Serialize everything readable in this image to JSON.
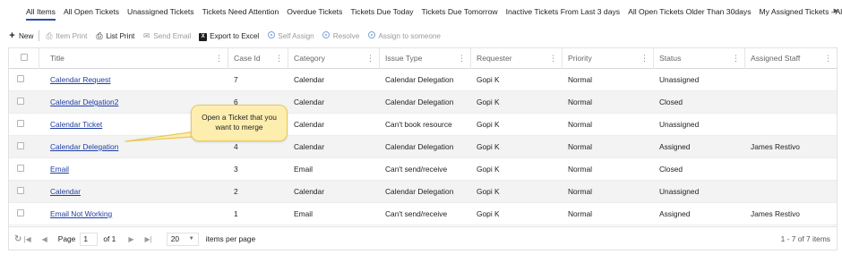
{
  "tabs": [
    {
      "label": "All Items",
      "active": true
    },
    {
      "label": "All Open Tickets"
    },
    {
      "label": "Unassigned Tickets"
    },
    {
      "label": "Tickets Need Attention"
    },
    {
      "label": "Overdue Tickets"
    },
    {
      "label": "Tickets Due Today"
    },
    {
      "label": "Tickets Due Tomorrow"
    },
    {
      "label": "Inactive Tickets From Last 3 days"
    },
    {
      "label": "All Open Tickets Older Than 30days"
    },
    {
      "label": "My Assigned Tickets - All"
    }
  ],
  "toolbar": {
    "new": "New",
    "item_print": "Item Print",
    "list_print": "List Print",
    "send_email": "Send Email",
    "export_excel": "Export to Excel",
    "self_assign": "Self Assign",
    "resolve": "Resolve",
    "assign_to_someone": "Assign to someone"
  },
  "columns": [
    "Title",
    "Case Id",
    "Category",
    "Issue Type",
    "Requester",
    "Priority",
    "Status",
    "Assigned Staff"
  ],
  "rows": [
    {
      "title": "Calendar Request",
      "case_id": "7",
      "category": "Calendar",
      "issue_type": "Calendar Delegation",
      "requester": "Gopi K",
      "priority": "Normal",
      "status": "Unassigned",
      "assigned_staff": ""
    },
    {
      "title": "Calendar Delgation2",
      "case_id": "6",
      "category": "Calendar",
      "issue_type": "Calendar Delegation",
      "requester": "Gopi K",
      "priority": "Normal",
      "status": "Closed",
      "assigned_staff": ""
    },
    {
      "title": "Calendar Ticket",
      "case_id": "5",
      "category": "Calendar",
      "issue_type": "Can't book resource",
      "requester": "Gopi K",
      "priority": "Normal",
      "status": "Unassigned",
      "assigned_staff": ""
    },
    {
      "title": "Calendar Delegation",
      "case_id": "4",
      "category": "Calendar",
      "issue_type": "Calendar Delegation",
      "requester": "Gopi K",
      "priority": "Normal",
      "status": "Assigned",
      "assigned_staff": "James Restivo"
    },
    {
      "title": "Email",
      "case_id": "3",
      "category": "Email",
      "issue_type": "Can't send/receive",
      "requester": "Gopi K",
      "priority": "Normal",
      "status": "Closed",
      "assigned_staff": ""
    },
    {
      "title": "Calendar",
      "case_id": "2",
      "category": "Calendar",
      "issue_type": "Calendar Delegation",
      "requester": "Gopi K",
      "priority": "Normal",
      "status": "Unassigned",
      "assigned_staff": ""
    },
    {
      "title": "Email Not Working",
      "case_id": "1",
      "category": "Email",
      "issue_type": "Can't send/receive",
      "requester": "Gopi K",
      "priority": "Normal",
      "status": "Assigned",
      "assigned_staff": "James Restivo"
    }
  ],
  "pager": {
    "page_label": "Page",
    "page_value": "1",
    "of_label": "of 1",
    "page_size": "20",
    "items_per_page": "items per page",
    "summary": "1 - 7 of 7 items"
  },
  "callout": {
    "line1": "Open a Ticket that you",
    "line2": "want to merge"
  },
  "colors": {
    "link": "#1f3ea6",
    "active_tab_underline": "#2b4fa6",
    "callout_fill": "#fdeeb0",
    "callout_border": "#e8c95a"
  }
}
